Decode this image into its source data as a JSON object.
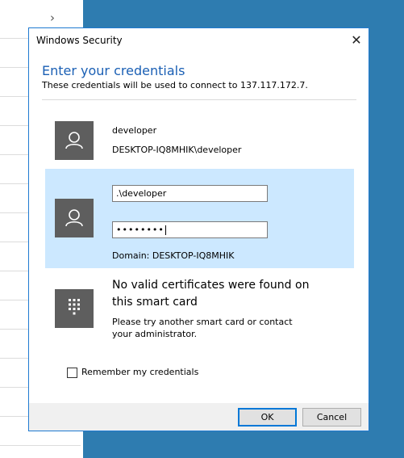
{
  "dialog": {
    "title": "Windows Security",
    "heading": "Enter your credentials",
    "subheading": "These credentials will be used to connect to 137.117.172.7."
  },
  "accounts": [
    {
      "icon": "user-icon",
      "name": "developer",
      "full_name": "DESKTOP-IQ8MHIK\\developer"
    }
  ],
  "credential_form": {
    "icon": "user-icon",
    "username_value": ".\\developer",
    "password_mask": "••••••••",
    "domain_text": "Domain: DESKTOP-IQ8MHIK"
  },
  "smart_card": {
    "icon": "keypad-icon",
    "title": "No valid certificates were found on this smart card",
    "description": "Please try another smart card or contact your administrator."
  },
  "remember": {
    "label": "Remember my credentials",
    "checked": false
  },
  "buttons": {
    "ok": "OK",
    "cancel": "Cancel"
  },
  "colors": {
    "accent": "#0078d7",
    "heading": "#1a5fb4",
    "selected_bg": "#cce8ff",
    "avatar_bg": "#5e5e5e",
    "desktop_bg": "#2e7cb0"
  }
}
